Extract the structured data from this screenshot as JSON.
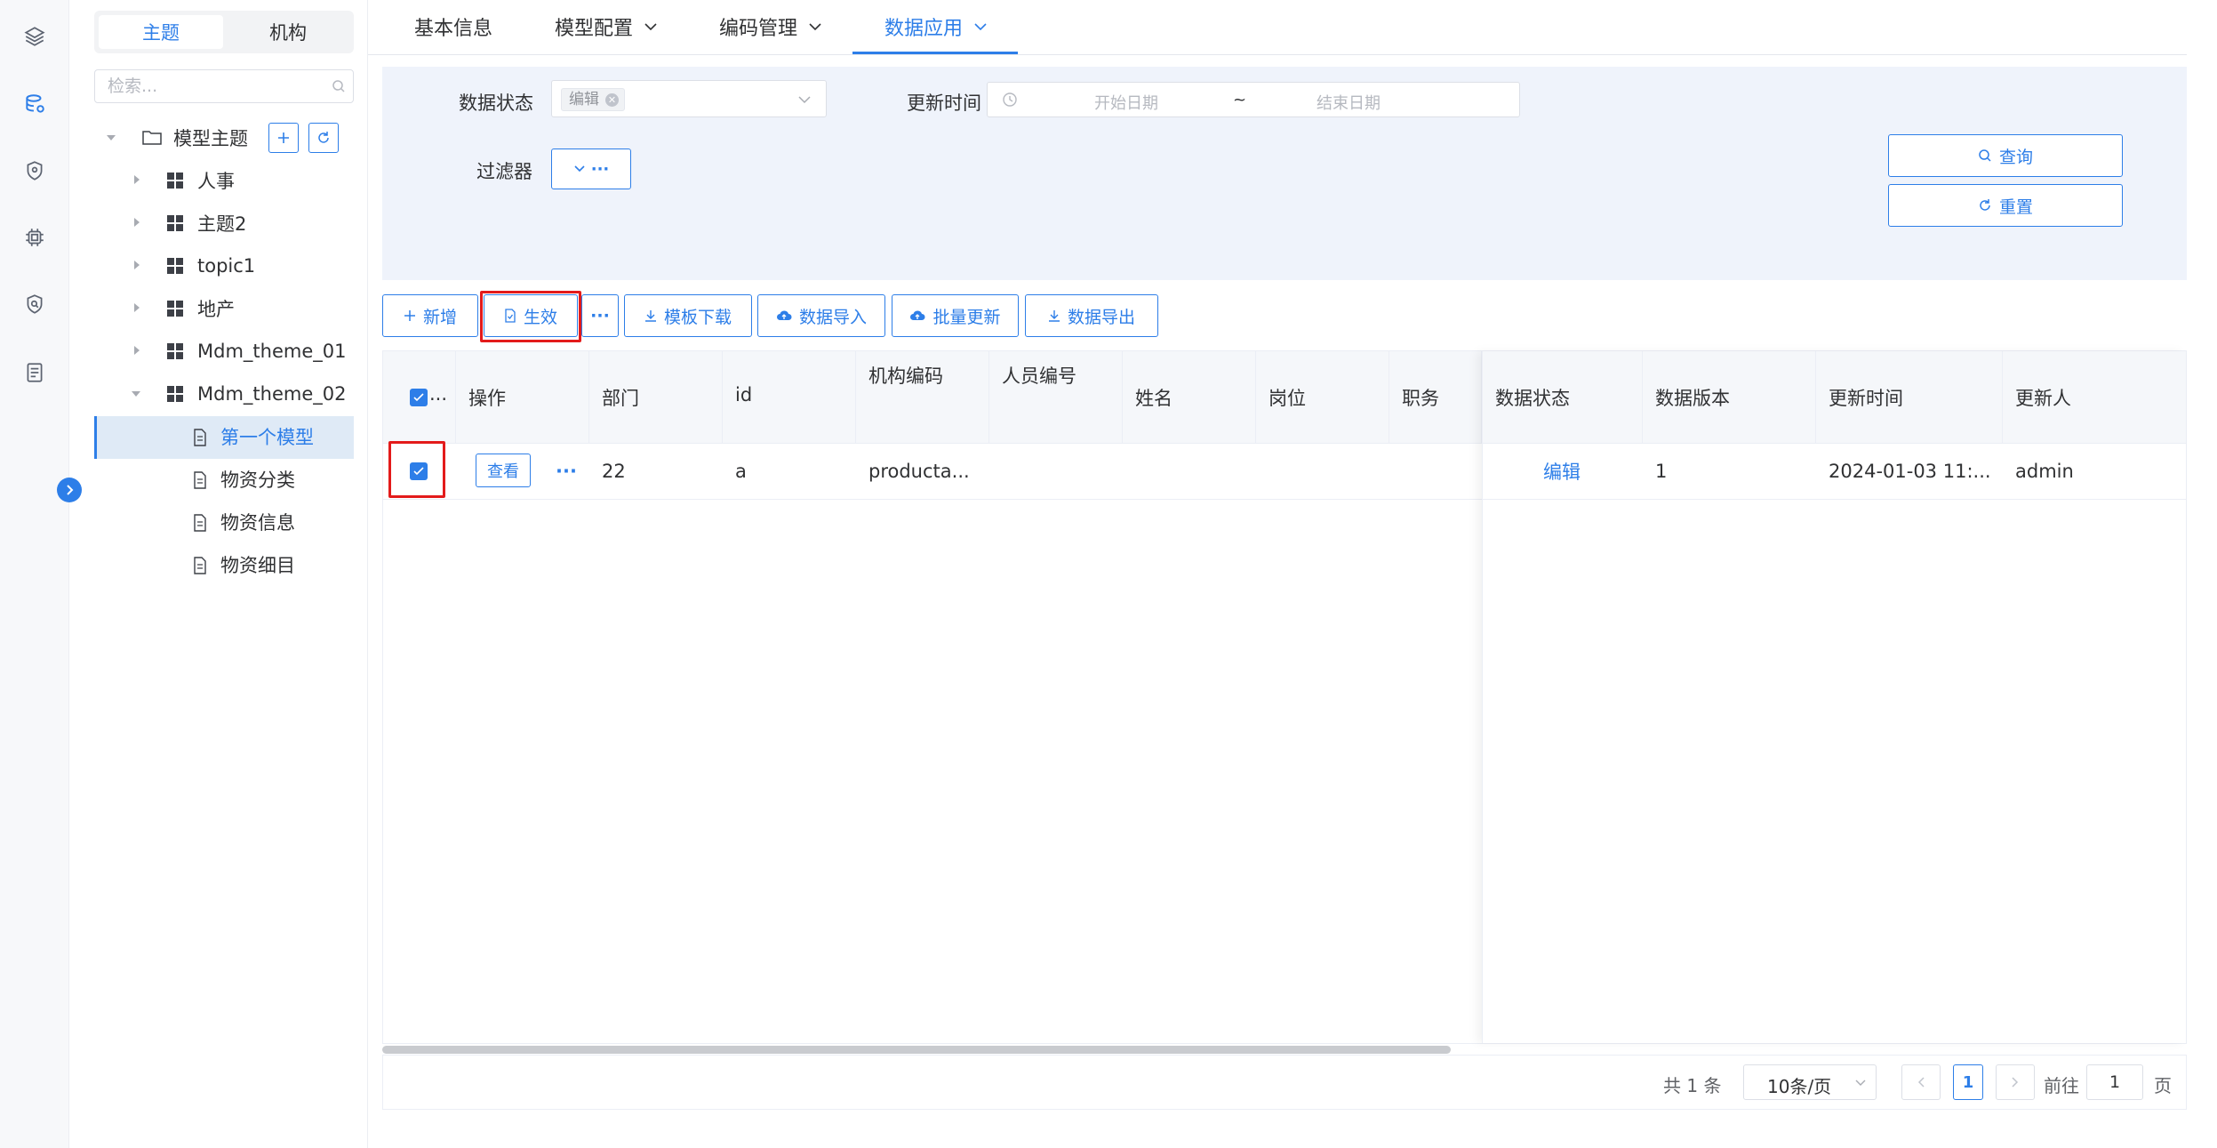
{
  "rail": {
    "icons": [
      "layers-icon",
      "database-icon",
      "shield-location-icon",
      "chip-icon",
      "shield-search-icon",
      "document-list-icon"
    ]
  },
  "tree": {
    "segments": {
      "topic": "主题",
      "org": "机构"
    },
    "search_placeholder": "检索...",
    "root": "模型主题",
    "nodes": [
      "人事",
      "主题2",
      "topic1",
      "地产",
      "Mdm_theme_01",
      "Mdm_theme_02"
    ],
    "leaves": [
      "第一个模型",
      "物资分类",
      "物资信息",
      "物资细目"
    ]
  },
  "tabs": [
    {
      "label": "基本信息"
    },
    {
      "label": "模型配置"
    },
    {
      "label": "编码管理"
    },
    {
      "label": "数据应用"
    }
  ],
  "filter": {
    "state_label": "数据状态",
    "state_tag": "编辑",
    "update_time_label": "更新时间",
    "start_placeholder": "开始日期",
    "range_sep": "~",
    "end_placeholder": "结束日期",
    "filter_label": "过滤器",
    "filter_btn": "···",
    "query": "查询",
    "reset": "重置"
  },
  "toolbar": {
    "add": "新增",
    "activate": "生效",
    "more": "···",
    "template_download": "模板下载",
    "data_import": "数据导入",
    "batch_update": "批量更新",
    "data_export": "数据导出"
  },
  "table": {
    "select_header": "...",
    "headers": [
      "操作",
      "部门",
      "id",
      "机构编码",
      "人员编号",
      "姓名",
      "岗位",
      "职务",
      "数据状态",
      "数据版本",
      "更新时间",
      "更新人"
    ],
    "row": {
      "view": "查看",
      "more": "···",
      "dept": "22",
      "id": "a",
      "org_code": "producta...",
      "person_no": "",
      "name": "",
      "post": "",
      "duty": "",
      "status": "编辑",
      "version": "1",
      "updated": "2024-01-03 11:...",
      "updater": "admin"
    }
  },
  "pager": {
    "total": "共 1 条",
    "page_size": "10条/页",
    "current": "1",
    "goto_label": "前往",
    "goto_value": "1",
    "page_unit": "页"
  },
  "colors": {
    "accent": "#2d7ee8",
    "highlight": "#e31b1b"
  }
}
